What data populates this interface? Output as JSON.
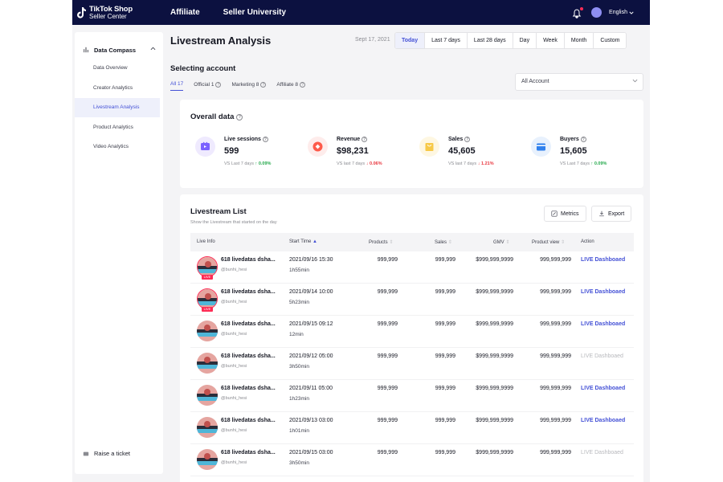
{
  "header": {
    "logo_line1": "TikTok Shop",
    "logo_line2": "Seller Center",
    "nav": [
      "Affiliate",
      "Seller University"
    ],
    "language": "English"
  },
  "sidebar": {
    "group": "Data Compass",
    "items": [
      {
        "label": "Data Overview",
        "active": false
      },
      {
        "label": "Creator Analytics",
        "active": false
      },
      {
        "label": "Livestream Analysis",
        "active": true
      },
      {
        "label": "Product Analytics",
        "active": false
      },
      {
        "label": "Video Analytics",
        "active": false
      }
    ],
    "ticket_label": "Raise a ticket"
  },
  "page": {
    "title": "Livestream Analysis",
    "date": "Sept 17, 2021",
    "ranges": [
      "Today",
      "Last 7 days",
      "Last 28 days",
      "Day",
      "Week",
      "Month",
      "Custom"
    ],
    "active_range": "Today"
  },
  "account": {
    "title": "Selecting account",
    "tabs": [
      {
        "label": "All 17",
        "active": true
      },
      {
        "label": "Official 1",
        "active": false
      },
      {
        "label": "Marketing 8",
        "active": false
      },
      {
        "label": "Affiliate 8",
        "active": false
      }
    ],
    "select_value": "All Account"
  },
  "overall": {
    "title": "Overall data",
    "metrics": [
      {
        "label": "Live sessions",
        "value": "599",
        "compare": "VS Last 7 days",
        "change": "0.09%",
        "trend": "up",
        "icon": "tv-icon",
        "color": "#7b61ff",
        "bg": "#efeafe"
      },
      {
        "label": "Revenue",
        "value": "$98,231",
        "compare": "VS last 7 days",
        "change": "0.06%",
        "trend": "down",
        "icon": "revenue-icon",
        "color": "#fe5a4a",
        "bg": "#feeceb"
      },
      {
        "label": "Sales",
        "value": "45,605",
        "compare": "VS last 7 days",
        "change": "1.21%",
        "trend": "down",
        "icon": "sales-bag-icon",
        "color": "#f7c948",
        "bg": "#fef7e2"
      },
      {
        "label": "Buyers",
        "value": "15,605",
        "compare": "VS Last 7 days",
        "change": "0.09%",
        "trend": "up",
        "icon": "buyers-card-icon",
        "color": "#2f80ed",
        "bg": "#e8f1fd"
      }
    ]
  },
  "list": {
    "title": "Livestream List",
    "subtitle": "Show the Livestream that started on the day",
    "metrics_btn": "Metrics",
    "export_btn": "Export",
    "columns": [
      "Live Info",
      "Start Time",
      "Products",
      "Sales",
      "GMV",
      "Product view",
      "Action"
    ],
    "rows": [
      {
        "name": "618 livedatas dsha...",
        "handle": "@bunhi_hesi",
        "start": "2021/09/16 15:30",
        "duration": "1h55min",
        "products": "999,999",
        "sales": "999,999",
        "gmv": "$999,999,9999",
        "views": "999,999,999",
        "action": "LIVE Dashboaed",
        "enabled": true,
        "live": true
      },
      {
        "name": "618 livedatas dsha...",
        "handle": "@bunhi_hesi",
        "start": "2021/09/14 10:00",
        "duration": "5h23min",
        "products": "999,999",
        "sales": "999,999",
        "gmv": "$999,999,9999",
        "views": "999,999,999",
        "action": "LIVE Dashboaed",
        "enabled": true,
        "live": true
      },
      {
        "name": "618 livedatas dsha...",
        "handle": "@bunhi_hesi",
        "start": "2021/09/15 09:12",
        "duration": "12min",
        "products": "999,999",
        "sales": "999,999",
        "gmv": "$999,999,9999",
        "views": "999,999,999",
        "action": "LIVE Dashboaed",
        "enabled": true,
        "live": false
      },
      {
        "name": "618 livedatas dsha...",
        "handle": "@bunhi_hesi",
        "start": "2021/09/12 05:00",
        "duration": "3h50min",
        "products": "999,999",
        "sales": "999,999",
        "gmv": "$999,999,9999",
        "views": "999,999,999",
        "action": "LIVE Dashboaed",
        "enabled": false,
        "live": false
      },
      {
        "name": "618 livedatas dsha...",
        "handle": "@bunhi_hesi",
        "start": "2021/09/11 05:00",
        "duration": "1h23min",
        "products": "999,999",
        "sales": "999,999",
        "gmv": "$999,999,9999",
        "views": "999,999,999",
        "action": "LIVE Dashboaed",
        "enabled": true,
        "live": false
      },
      {
        "name": "618 livedatas dsha...",
        "handle": "@bunhi_hesi",
        "start": "2021/09/13 03:00",
        "duration": "1h01min",
        "products": "999,999",
        "sales": "999,999",
        "gmv": "$999,999,9999",
        "views": "999,999,999",
        "action": "LIVE Dashboaed",
        "enabled": true,
        "live": false
      },
      {
        "name": "618 livedatas dsha...",
        "handle": "@bunhi_hesi",
        "start": "2021/09/15 03:00",
        "duration": "3h50min",
        "products": "999,999",
        "sales": "999,999",
        "gmv": "$999,999,9999",
        "views": "999,999,999",
        "action": "LIVE Dashboaed",
        "enabled": false,
        "live": false
      }
    ]
  }
}
